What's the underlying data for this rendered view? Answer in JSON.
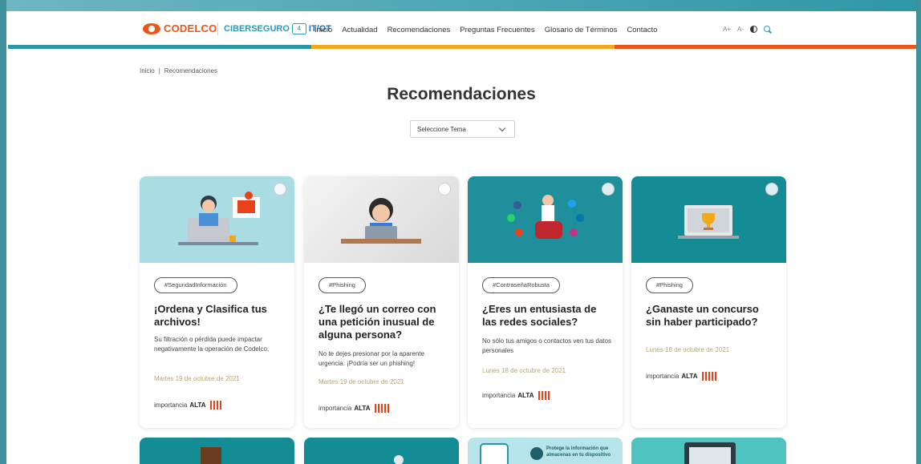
{
  "header": {
    "logo_text": "CODELCO",
    "brand_a": "CIBERSEGURO",
    "brand_box": "4",
    "brand_b": "IT/OT",
    "nav": [
      "Inicio",
      "Actualidad",
      "Recomendaciones",
      "Preguntas Frecuentes",
      "Glosario de Términos",
      "Contacto"
    ],
    "font_increase": "A+",
    "font_decrease": "A-"
  },
  "breadcrumb": {
    "home": "Inicio",
    "sep": "|",
    "current": "Recomendaciones"
  },
  "page_title": "Recomendaciones",
  "topic_select": {
    "value": "Seleccione Tema"
  },
  "cards": [
    {
      "tag": "#SeguridadInformación",
      "title": "¡Ordena y Clasifica tus archivos!",
      "desc": "Su filtración o pérdida puede impactar negativamente la operación de Codelco.",
      "date": "Martes 19 de octubre de 2021",
      "importance_label": "importancia",
      "importance_level": "ALTA",
      "bars": 4
    },
    {
      "tag": "#Phishing",
      "title": "¿Te llegó un correo con una petición inusual de alguna persona?",
      "desc": "No te dejes presionar por la aparente urgencia. ¡Podría ser un phishing!",
      "date": "Martes 19 de octubre de 2021",
      "importance_label": "importancia",
      "importance_level": "ALTA",
      "bars": 5
    },
    {
      "tag": "#ContraseñaRobusta",
      "title": "¿Eres un entusiasta de las redes sociales?",
      "desc": "No sólo tus amigos o contactos ven tus datos personales",
      "date": "Lunes 18 de octubre de 2021",
      "importance_label": "importancia",
      "importance_level": "ALTA",
      "bars": 4
    },
    {
      "tag": "#Phishing",
      "title": "¿Ganaste un concurso sin haber participado?",
      "desc": "",
      "date": "Lunes 18 de octubre de 2021",
      "importance_label": "importancia",
      "importance_level": "ALTA",
      "bars": 5
    }
  ],
  "bottom_teaser_text": "Protege la información que almacenas en tu dispositivo",
  "colors": {
    "teal": "#2a96a8",
    "yellow": "#f2a81d",
    "orange": "#e8571a",
    "importance_red": "#e8421a"
  }
}
